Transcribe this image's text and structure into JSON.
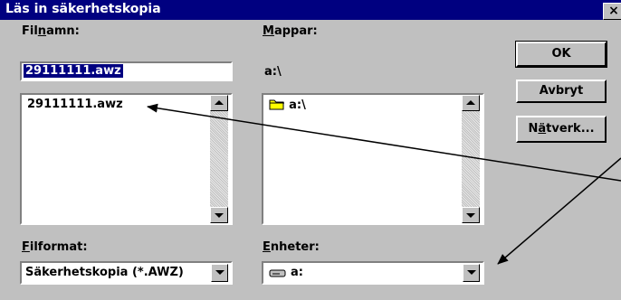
{
  "window": {
    "title": "Läs in säkerhetskopia",
    "close_glyph": "×"
  },
  "filename": {
    "label_pre": "Fil",
    "label_u": "n",
    "label_post": "amn:",
    "value": "29111111.awz",
    "list": [
      "29111111.awz"
    ]
  },
  "folders": {
    "label_u": "M",
    "label_post": "appar:",
    "current_path": "a:\\",
    "list": [
      "a:\\"
    ]
  },
  "buttons": {
    "ok": "OK",
    "cancel": "Avbryt",
    "network_pre": "N",
    "network_u": "ä",
    "network_post": "tverk..."
  },
  "fileformat": {
    "label_u": "F",
    "label_post": "ilformat:",
    "selected": "Säkerhetskopia (*.AWZ)"
  },
  "drives": {
    "label_u": "E",
    "label_post": "nheter:",
    "selected": "a:"
  },
  "icons": [
    "close-icon",
    "folder-icon",
    "drive-icon",
    "scroll-up-icon",
    "scroll-down-icon",
    "dropdown-arrow-icon",
    "annotation-arrow"
  ]
}
